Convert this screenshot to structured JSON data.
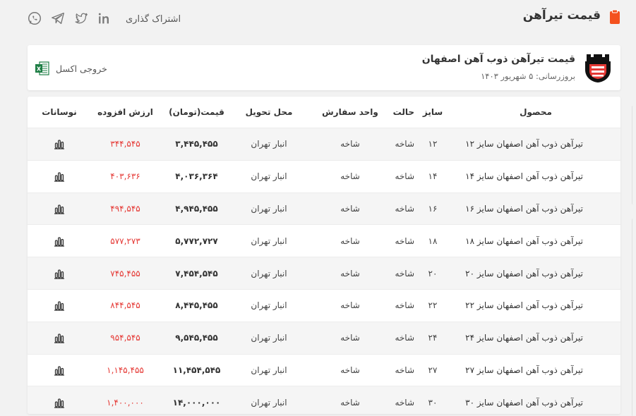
{
  "header": {
    "title": "قیمت تیرآهن",
    "share_label": "اشتراک گذاری",
    "social": [
      "linkedin-icon",
      "twitter-icon",
      "telegram-icon",
      "whatsapp-icon"
    ]
  },
  "card": {
    "title": "قیمت تیرآهن ذوب آهن اصفهان",
    "updated": "بروزرسانی: ۵ شهریور ۱۴۰۳",
    "export_label": "خروجی اکسل"
  },
  "table": {
    "headers": {
      "product": "محصول",
      "size": "سایز",
      "state": "حالت",
      "unit": "واحد سفارش",
      "delivery": "محل تحویل",
      "price": "قیمت(تومان)",
      "vat": "ارزش افزوده",
      "chart": "نوسانات"
    },
    "rows": [
      {
        "product": "تیرآهن ذوب آهن اصفهان سایز ۱۲",
        "size": "۱۲",
        "state": "شاخه",
        "unit": "شاخه",
        "delivery": "انبار تهران",
        "price": "۳,۴۴۵,۴۵۵",
        "vat": "۳۴۴,۵۴۵"
      },
      {
        "product": "تیرآهن ذوب آهن اصفهان سایز ۱۴",
        "size": "۱۴",
        "state": "شاخه",
        "unit": "شاخه",
        "delivery": "انبار تهران",
        "price": "۴,۰۳۶,۳۶۴",
        "vat": "۴۰۳,۶۳۶"
      },
      {
        "product": "تیرآهن ذوب آهن اصفهان سایز ۱۶",
        "size": "۱۶",
        "state": "شاخه",
        "unit": "شاخه",
        "delivery": "انبار تهران",
        "price": "۴,۹۴۵,۴۵۵",
        "vat": "۴۹۴,۵۴۵"
      },
      {
        "product": "تیرآهن ذوب آهن اصفهان سایز ۱۸",
        "size": "۱۸",
        "state": "شاخه",
        "unit": "شاخه",
        "delivery": "انبار تهران",
        "price": "۵,۷۷۲,۷۲۷",
        "vat": "۵۷۷,۲۷۳"
      },
      {
        "product": "تیرآهن ذوب آهن اصفهان سایز ۲۰",
        "size": "۲۰",
        "state": "شاخه",
        "unit": "شاخه",
        "delivery": "انبار تهران",
        "price": "۷,۴۵۴,۵۴۵",
        "vat": "۷۴۵,۴۵۵"
      },
      {
        "product": "تیرآهن ذوب آهن اصفهان سایز ۲۲",
        "size": "۲۲",
        "state": "شاخه",
        "unit": "شاخه",
        "delivery": "انبار تهران",
        "price": "۸,۴۴۵,۴۵۵",
        "vat": "۸۴۴,۵۴۵"
      },
      {
        "product": "تیرآهن ذوب آهن اصفهان سایز ۲۴",
        "size": "۲۴",
        "state": "شاخه",
        "unit": "شاخه",
        "delivery": "انبار تهران",
        "price": "۹,۵۴۵,۴۵۵",
        "vat": "۹۵۴,۵۴۵"
      },
      {
        "product": "تیرآهن ذوب آهن اصفهان سایز ۲۷",
        "size": "۲۷",
        "state": "شاخه",
        "unit": "شاخه",
        "delivery": "انبار تهران",
        "price": "۱۱,۴۵۴,۵۴۵",
        "vat": "۱,۱۴۵,۴۵۵"
      },
      {
        "product": "تیرآهن ذوب آهن اصفهان سایز ۳۰",
        "size": "۳۰",
        "state": "شاخه",
        "unit": "شاخه",
        "delivery": "انبار تهران",
        "price": "۱۴,۰۰۰,۰۰۰",
        "vat": "۱,۴۰۰,۰۰۰"
      }
    ]
  },
  "colors": {
    "accent": "#f4511e",
    "vat_text": "#e53935",
    "excel_green": "#1e7e45"
  }
}
